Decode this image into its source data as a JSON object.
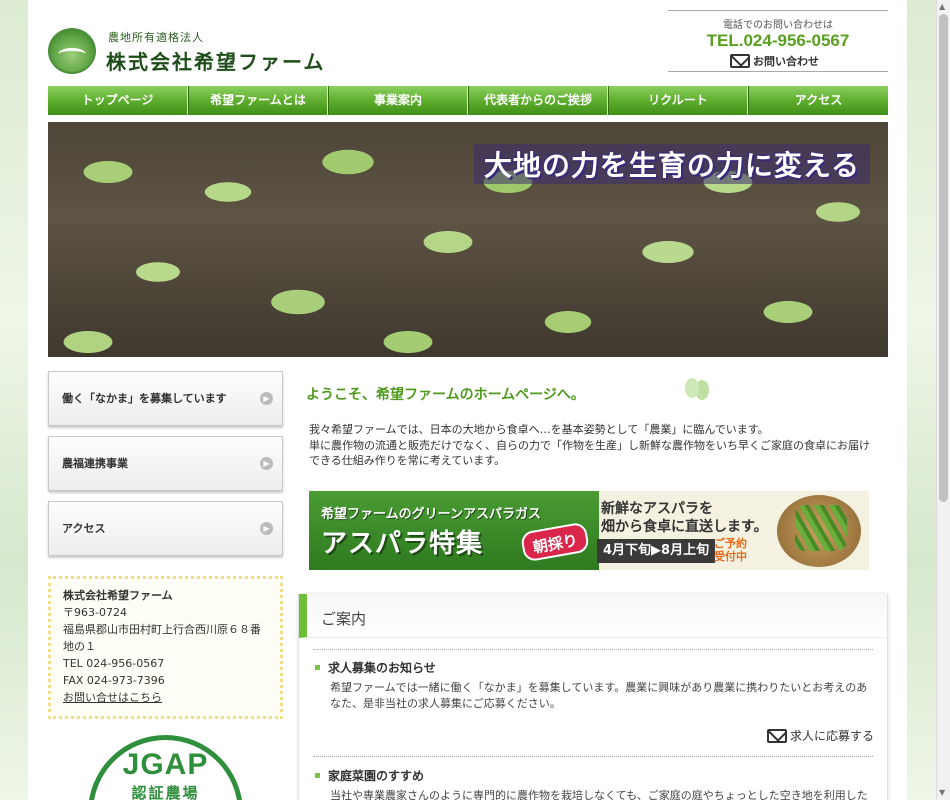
{
  "header": {
    "logo_sub": "農地所有適格法人",
    "logo_main": "株式会社希望ファーム",
    "contact_caption": "電話でのお問い合わせは",
    "tel": "TEL.024-956-0567",
    "mail_label": "お問い合わせ"
  },
  "nav": {
    "items": [
      {
        "label": "トップページ"
      },
      {
        "label": "希望ファームとは"
      },
      {
        "label": "事業案内"
      },
      {
        "label": "代表者からのご挨拶"
      },
      {
        "label": "リクルート"
      },
      {
        "label": "アクセス"
      }
    ]
  },
  "hero": {
    "caption": "大地の力を生育の力に変える"
  },
  "sidebar": {
    "buttons": [
      {
        "label": "働く「なかま」を募集しています"
      },
      {
        "label": "農福連携事業"
      },
      {
        "label": "アクセス"
      }
    ],
    "company": {
      "name": "株式会社希望ファーム",
      "zip": "〒963-0724",
      "address": "福島県郡山市田村町上行合西川原６８番地の１",
      "tel": "TEL 024-956-0567",
      "fax": "FAX 024-973-7396",
      "contact_link": "お問い合せはこちら"
    },
    "jgap": {
      "title": "JGAP",
      "sub": "認証農場"
    }
  },
  "main": {
    "welcome": "ようこそ、希望ファームのホームページへ。",
    "intro_1": "我々希望ファームでは、日本の大地から食卓へ…を基本姿勢として「農業」に臨んでいます。",
    "intro_2": "単に農作物の流通と販売だけでなく、自らの力で「作物を生産」し新鮮な農作物をいち早くご家庭の食卓にお届けできる仕組み作りを常に考えています。",
    "banner": {
      "sub": "希望ファームのグリーンアスパラガス",
      "title": "アスパラ特集",
      "badge": "朝採り",
      "copy_1": "新鮮なアスパラを",
      "copy_2": "畑から食卓に直送します。",
      "date": "4月下旬▶8月上旬",
      "reserve_1": "ご予約",
      "reserve_2": "受付中"
    },
    "info": {
      "title": "ご案内",
      "items": [
        {
          "title": "求人募集のお知らせ",
          "body": "希望ファームでは一緒に働く「なかま」を募集しています。農業に興味があり農業に携わりたいとお考えのあなた、是非当社の求人募集にご応募ください。",
          "link": "求人に応募する"
        },
        {
          "title": "家庭菜園のすすめ",
          "body": "当社や専業農家さんのように専門的に農作物を栽培しなくても、ご家庭の庭やちょっとした空き地を利用した"
        }
      ]
    }
  }
}
